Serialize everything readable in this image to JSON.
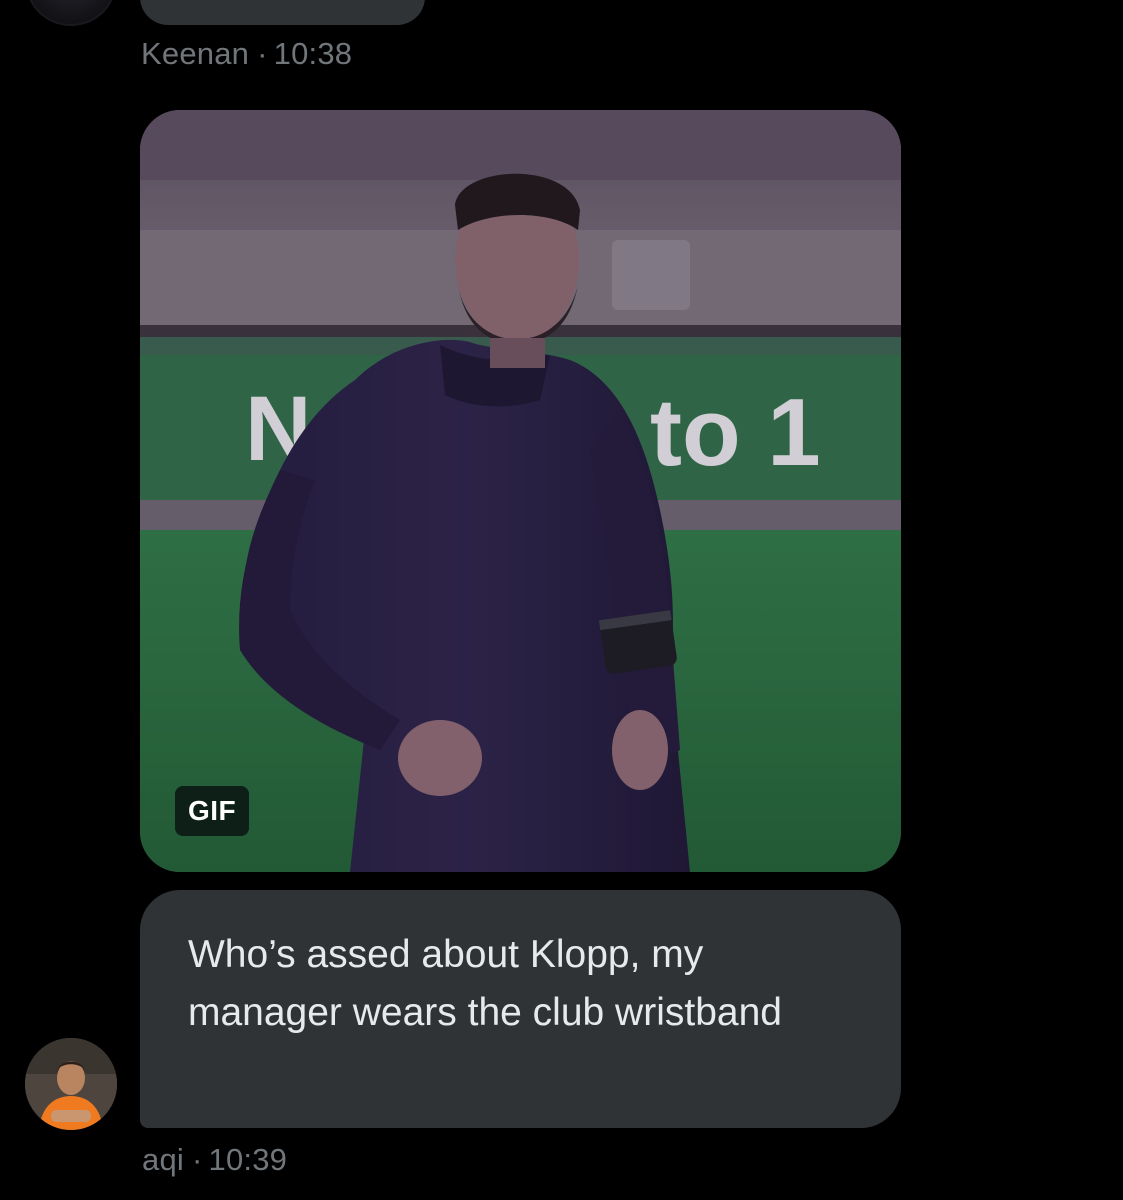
{
  "previous_message": {
    "sender": "Keenan",
    "separator": "·",
    "time": "10:38"
  },
  "gif": {
    "badge": "GIF",
    "banner_text_left": "N",
    "banner_text_right": "to 1"
  },
  "message": {
    "text": "Who’s assed about Klopp, my manager wears the club wristband",
    "sender": "aqi",
    "separator": "·",
    "time": "10:39"
  },
  "colors": {
    "background": "#000000",
    "bubble": "#2f3336",
    "meta_text": "#71767b",
    "message_text": "#e7e9ea",
    "pitch_green": "#2c7a44",
    "avatar_shirt": "#f07a20"
  },
  "icons": {
    "avatar_prev": "user-avatar",
    "avatar_current": "user-avatar"
  }
}
